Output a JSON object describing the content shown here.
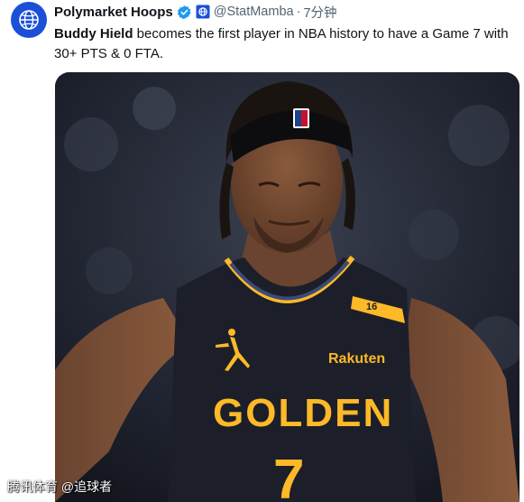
{
  "account": {
    "display_name": "Polymarket Hoops",
    "handle": "@StatMamba",
    "separator": "·",
    "time": "7分钟",
    "avatar_icon": "polymarket-globe-icon",
    "verified_icon": "verified-badge-icon",
    "affiliate_icon": "affiliate-badge-icon",
    "brand_color": "#1b4fd8",
    "verified_color": "#1d9bf0"
  },
  "tweet": {
    "bold_name": "Buddy Hield",
    "text": " becomes the first player in NBA history to have a Game 7 with 30+ PTS & 0 FTA."
  },
  "photo": {
    "icon": "player-photo",
    "jersey_team": "GOLDEN",
    "jersey_number": "7",
    "jersey_sponsor": "Rakuten",
    "jersey_side_number": "16",
    "jersey_color": "#1c1f29",
    "trim_color": "#fdb927"
  },
  "watermark": {
    "text": "腾讯体育 @追球者"
  }
}
